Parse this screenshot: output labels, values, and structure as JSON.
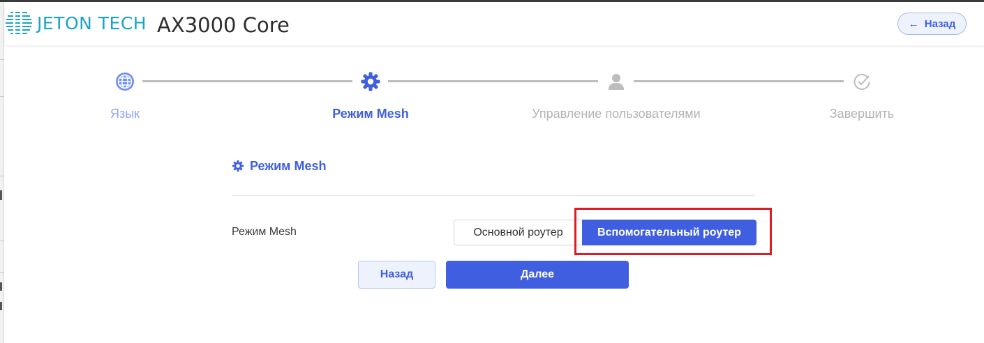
{
  "header": {
    "logo_text": "JETON TECH",
    "product_title": "AX3000 Core",
    "back_label": "Назад"
  },
  "steps": [
    {
      "label": "Язык",
      "icon": "globe-icon",
      "state": "done"
    },
    {
      "label": "Режим Mesh",
      "icon": "gear-icon",
      "state": "active"
    },
    {
      "label": "Управление пользователями",
      "icon": "user-icon",
      "state": "pending"
    },
    {
      "label": "Завершить",
      "icon": "check-circle-icon",
      "state": "pending"
    }
  ],
  "panel": {
    "title": "Режим Mesh",
    "field_label": "Режим Mesh",
    "options": [
      "Основной роутер",
      "Вспомогательный роутер"
    ],
    "selected": "Вспомогательный роутер"
  },
  "actions": {
    "back_label": "Назад",
    "next_label": "Далее"
  },
  "colors": {
    "accent": "#3f5fe0",
    "step_done": "#6f8ef5",
    "step_pending": "#bdbdbd",
    "logo": "#1aa3c4",
    "highlight": "#e11b22"
  }
}
